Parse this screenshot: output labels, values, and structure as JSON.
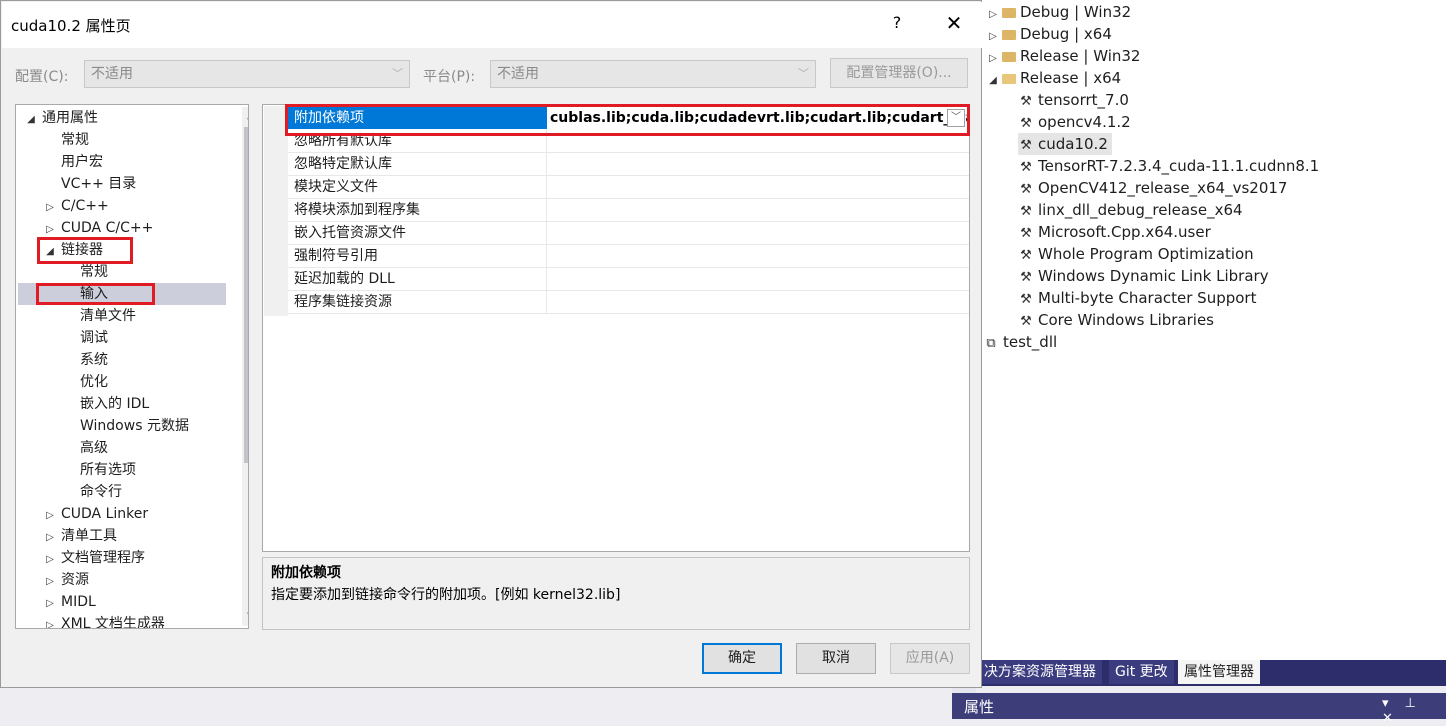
{
  "dialog": {
    "title": "cuda10.2 属性页",
    "help": "?",
    "close": "✕",
    "config_label": "配置(C):",
    "config_value": "不适用",
    "platform_label": "平台(P):",
    "platform_value": "不适用",
    "config_manager": "配置管理器(O)...",
    "ok": "确定",
    "cancel": "取消",
    "apply": "应用(A)"
  },
  "left_tree": [
    {
      "label": "通用属性",
      "indent": 0,
      "state": "expanded"
    },
    {
      "label": "常规",
      "indent": 1
    },
    {
      "label": "用户宏",
      "indent": 1
    },
    {
      "label": "VC++ 目录",
      "indent": 1
    },
    {
      "label": "C/C++",
      "indent": 1,
      "state": "collapsed"
    },
    {
      "label": "CUDA C/C++",
      "indent": 1,
      "state": "collapsed"
    },
    {
      "label": "链接器",
      "indent": 1,
      "state": "expanded"
    },
    {
      "label": "常规",
      "indent": 2
    },
    {
      "label": "输入",
      "indent": 2,
      "selected": true
    },
    {
      "label": "清单文件",
      "indent": 2
    },
    {
      "label": "调试",
      "indent": 2
    },
    {
      "label": "系统",
      "indent": 2
    },
    {
      "label": "优化",
      "indent": 2
    },
    {
      "label": "嵌入的 IDL",
      "indent": 2
    },
    {
      "label": "Windows 元数据",
      "indent": 2
    },
    {
      "label": "高级",
      "indent": 2
    },
    {
      "label": "所有选项",
      "indent": 2
    },
    {
      "label": "命令行",
      "indent": 2
    },
    {
      "label": "CUDA Linker",
      "indent": 1,
      "state": "collapsed"
    },
    {
      "label": "清单工具",
      "indent": 1,
      "state": "collapsed"
    },
    {
      "label": "文档管理程序",
      "indent": 1,
      "state": "collapsed"
    },
    {
      "label": "资源",
      "indent": 1,
      "state": "collapsed"
    },
    {
      "label": "MIDL",
      "indent": 1,
      "state": "collapsed"
    },
    {
      "label": "XML 文档生成器",
      "indent": 1,
      "state": "collapsed"
    }
  ],
  "grid": {
    "selected_name": "附加依赖项",
    "selected_value": "cublas.lib;cuda.lib;cudadevrt.lib;cudart.lib;cudart_static.lib;",
    "rows": [
      "忽略所有默认库",
      "忽略特定默认库",
      "模块定义文件",
      "将模块添加到程序集",
      "嵌入托管资源文件",
      "强制符号引用",
      "延迟加载的 DLL",
      "程序集链接资源"
    ]
  },
  "description": {
    "title": "附加依赖项",
    "text": "指定要添加到链接命令行的附加项。[例如 kernel32.lib]"
  },
  "property_manager": {
    "items": [
      {
        "label": "Debug | Win32",
        "kind": "folder",
        "level": 0
      },
      {
        "label": "Debug | x64",
        "kind": "folder",
        "level": 0
      },
      {
        "label": "Release | Win32",
        "kind": "folder",
        "level": 0
      },
      {
        "label": "Release | x64",
        "kind": "folder-open",
        "level": 0
      },
      {
        "label": "tensorrt_7.0",
        "kind": "sheet",
        "level": 1
      },
      {
        "label": "opencv4.1.2",
        "kind": "sheet",
        "level": 1
      },
      {
        "label": "cuda10.2",
        "kind": "sheet",
        "level": 1,
        "selected": true
      },
      {
        "label": "TensorRT-7.2.3.4_cuda-11.1.cudnn8.1",
        "kind": "sheet",
        "level": 1
      },
      {
        "label": "OpenCV412_release_x64_vs2017",
        "kind": "sheet",
        "level": 1
      },
      {
        "label": "linx_dll_debug_release_x64",
        "kind": "sheet",
        "level": 1
      },
      {
        "label": "Microsoft.Cpp.x64.user",
        "kind": "sheet",
        "level": 1
      },
      {
        "label": "Whole Program Optimization",
        "kind": "sheet",
        "level": 1
      },
      {
        "label": "Windows Dynamic Link Library",
        "kind": "sheet",
        "level": 1
      },
      {
        "label": "Multi-byte Character Support",
        "kind": "sheet",
        "level": 1
      },
      {
        "label": "Core Windows Libraries",
        "kind": "sheet",
        "level": 1
      },
      {
        "label": "test_dll",
        "kind": "project",
        "level": -1
      }
    ],
    "tabs": [
      "决方案资源管理器",
      "Git 更改",
      "属性管理器"
    ],
    "active_tab": 2,
    "properties_title": "属性",
    "properties_icons": "▾ ⊥ ✕"
  }
}
